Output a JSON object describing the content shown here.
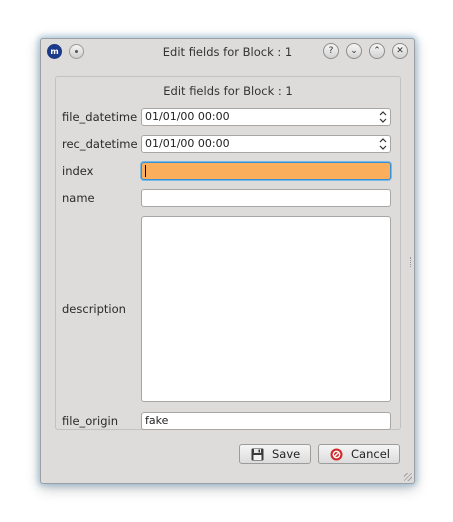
{
  "window": {
    "title": "Edit fields for Block : 1",
    "app_icon_text": "m",
    "help_glyph": "?",
    "minimize_glyph": "⌄",
    "maximize_glyph": "⌃",
    "close_glyph": "✕"
  },
  "panel": {
    "title": "Edit fields for Block : 1"
  },
  "fields": {
    "file_datetime": {
      "label": "file_datetime",
      "value": "01/01/00 00:00"
    },
    "rec_datetime": {
      "label": "rec_datetime",
      "value": "01/01/00 00:00"
    },
    "index": {
      "label": "index",
      "value": ""
    },
    "name": {
      "label": "name",
      "value": ""
    },
    "description": {
      "label": "description",
      "value": ""
    },
    "file_origin": {
      "label": "file_origin",
      "value": "fake"
    }
  },
  "buttons": {
    "save_label": "Save",
    "cancel_label": "Cancel",
    "save_icon": "floppy-disk-icon",
    "cancel_icon": "cancel-icon"
  },
  "colors": {
    "focused_field": "#fbae5c",
    "focus_border": "#3a8fd0",
    "window_bg": "#dedcda",
    "cancel_red": "#d02a2a"
  }
}
